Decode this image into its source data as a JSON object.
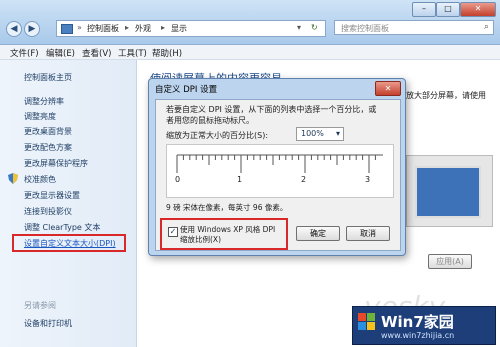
{
  "window": {
    "breadcrumb": [
      "控制面板",
      "外观",
      "显示"
    ],
    "search_placeholder": "搜索控制面板",
    "controls": {
      "minimize": "–",
      "maximize": "□",
      "close": "✕"
    }
  },
  "menu": [
    "文件(F)",
    "编辑(E)",
    "查看(V)",
    "工具(T)",
    "帮助(H)"
  ],
  "sidebar": {
    "home": "控制面板主页",
    "items": [
      "调整分辨率",
      "调整亮度",
      "更改桌面背景",
      "更改配色方案",
      "更改屏幕保护程序",
      "校准颜色",
      "更改显示器设置",
      "连接到投影仪",
      "调整 ClearType 文本",
      "设置自定义文本大小(DPI)"
    ],
    "see_also_title": "另请参阅",
    "see_also": [
      "设备和打印机"
    ]
  },
  "main": {
    "heading_partial": "使阅读屏幕上的内容更容易",
    "text_right": "放大部分屏幕，请使用",
    "apply_button": "应用(A)"
  },
  "dialog": {
    "title": "自定义 DPI 设置",
    "close": "✕",
    "description": "若要自定义 DPI 设置，从下面的列表中选择一个百分比，或者用您的鼠标拖动标尺。",
    "scale_label": "缩放为正常大小的百分比(S):",
    "scale_value": "100%",
    "ruler_numbers": [
      "0",
      "1",
      "2",
      "3"
    ],
    "info": "9 磅 宋体在像素，每英寸 96 像素。",
    "checkbox_label": "使用 Windows XP 风格 DPI 缩放比例(X)",
    "checkbox_checked": true,
    "ok": "确定",
    "cancel": "取消"
  },
  "watermark": {
    "site": "Win7家园",
    "url": "www.win7zhijia.cn",
    "faint": "yesky"
  }
}
